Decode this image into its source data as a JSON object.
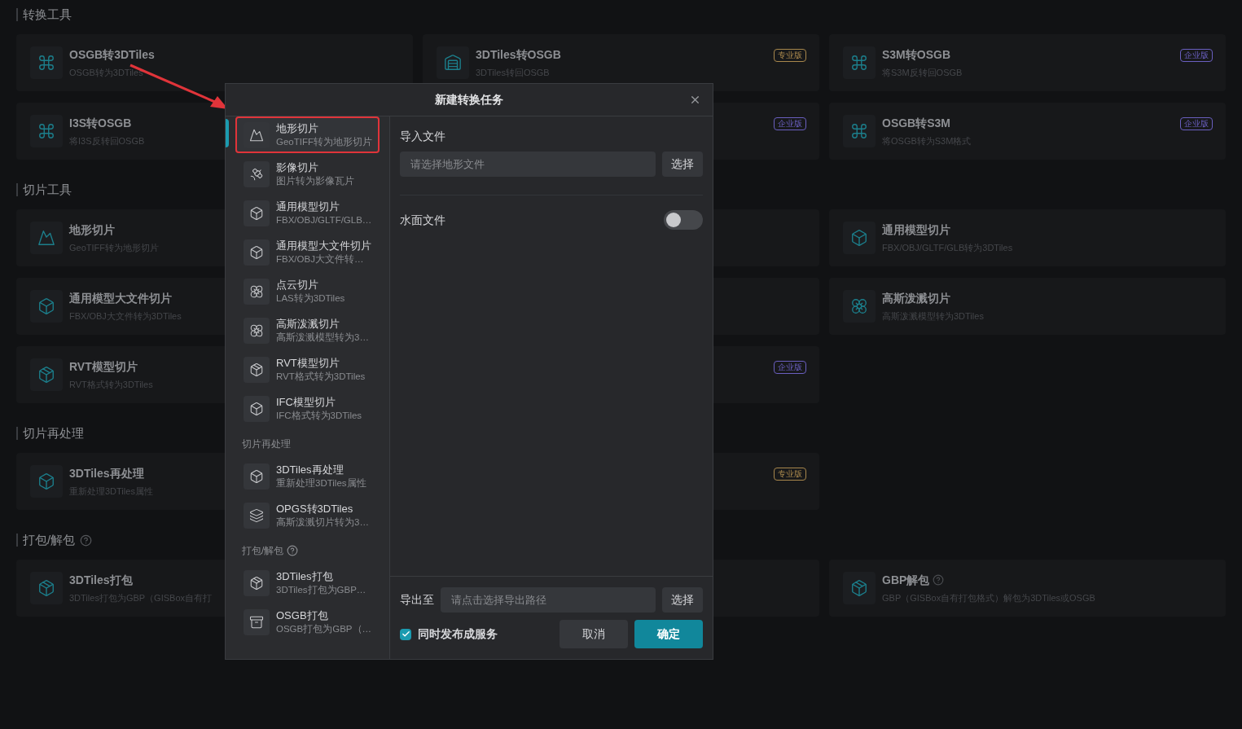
{
  "sections": [
    {
      "title": "转换工具",
      "help_icon": false,
      "cards": [
        {
          "kind": "tool",
          "title": "OSGB转3DTiles",
          "description": "OSGB转为3DTiles"
        },
        {
          "kind": "tool",
          "title": "3DTiles转OSGB",
          "description": "3DTiles转回OSGB",
          "badge": {
            "text": "专业版",
            "color": "#a8874c"
          }
        },
        {
          "kind": "tool",
          "title": "S3M转OSGB",
          "description": "将S3M反转回OSGB",
          "badge": {
            "text": "企业版",
            "color": "#6a5fc0"
          }
        },
        {
          "kind": "tool",
          "title": "I3S转OSGB",
          "description": "将I3S反转回OSGB"
        },
        {
          "kind": "covered",
          "badge": {
            "text": "企业版",
            "color": "#6a5fc0"
          }
        },
        {
          "kind": "tool",
          "title": "OSGB转S3M",
          "description": "将OSGB转为S3M格式",
          "badge": {
            "text": "企业版",
            "color": "#6a5fc0"
          }
        }
      ]
    },
    {
      "title": "切片工具",
      "help_icon": false,
      "cards": [
        {
          "kind": "tool",
          "title": "地形切片",
          "description": "GeoTIFF转为地形切片"
        },
        {
          "kind": "covered"
        },
        {
          "kind": "tool",
          "title": "通用模型切片",
          "description": "FBX/OBJ/GLTF/GLB转为3DTiles"
        },
        {
          "kind": "tool",
          "title": "通用模型大文件切片",
          "description": "FBX/OBJ大文件转为3DTiles"
        },
        {
          "kind": "covered"
        },
        {
          "kind": "tool",
          "title": "高斯泼溅切片",
          "description": "高斯泼溅模型转为3DTiles"
        },
        {
          "kind": "tool",
          "title": "RVT模型切片",
          "description": "RVT格式转为3DTiles"
        },
        {
          "kind": "covered",
          "badge": {
            "text": "企业版",
            "color": "#6a5fc0"
          }
        }
      ]
    },
    {
      "title": "切片再处理",
      "help_icon": false,
      "cards": [
        {
          "kind": "tool",
          "title": "3DTiles再处理",
          "description": "重新处理3DTiles属性"
        },
        {
          "kind": "covered",
          "badge": {
            "text": "专业版",
            "color": "#a8874c"
          }
        }
      ]
    },
    {
      "title": "打包/解包",
      "help_icon": true,
      "cards": [
        {
          "kind": "tool",
          "title": "3DTiles打包",
          "description": "3DTiles打包为GBP（GISBox自有打"
        },
        {
          "kind": "covered"
        },
        {
          "kind": "tool",
          "title": "GBP解包",
          "help_icon": true,
          "description": "GBP（GISBox自有打包格式）解包为3DTiles或OSGB"
        }
      ]
    }
  ],
  "dialog": {
    "title": "新建转换任务",
    "nav": [
      {
        "kind": "item",
        "title": "地形切片",
        "description": "GeoTIFF转为地形切片",
        "selected": true
      },
      {
        "kind": "item",
        "title": "影像切片",
        "description": "图片转为影像瓦片",
        "selected": false
      },
      {
        "kind": "item",
        "title": "通用模型切片",
        "description": "FBX/OBJ/GLTF/GLB…",
        "selected": false
      },
      {
        "kind": "item",
        "title": "通用模型大文件切片",
        "description": "FBX/OBJ大文件转…",
        "selected": false
      },
      {
        "kind": "item",
        "title": "点云切片",
        "description": "LAS转为3DTiles",
        "selected": false
      },
      {
        "kind": "item",
        "title": "高斯泼溅切片",
        "description": "高斯泼溅模型转为3…",
        "selected": false
      },
      {
        "kind": "item",
        "title": "RVT模型切片",
        "description": "RVT格式转为3DTiles",
        "selected": false
      },
      {
        "kind": "item",
        "title": "IFC模型切片",
        "description": "IFC格式转为3DTiles",
        "selected": false
      },
      {
        "kind": "group",
        "label": "切片再处理",
        "help_icon": false
      },
      {
        "kind": "item",
        "title": "3DTiles再处理",
        "description": "重新处理3DTiles属性",
        "selected": false
      },
      {
        "kind": "item",
        "title": "OPGS转3DTiles",
        "description": "高斯泼溅切片转为3…",
        "selected": false
      },
      {
        "kind": "group",
        "label": "打包/解包",
        "help_icon": true
      },
      {
        "kind": "item",
        "title": "3DTiles打包",
        "description": "3DTiles打包为GBP…",
        "selected": false
      },
      {
        "kind": "item",
        "title": "OSGB打包",
        "description": "OSGB打包为GBP（…",
        "selected": false
      }
    ],
    "import": {
      "label": "导入文件",
      "placeholder": "请选择地形文件",
      "button": "选择"
    },
    "water": {
      "label": "水面文件",
      "on": false
    },
    "export": {
      "label": "导出至",
      "placeholder": "请点击选择导出路径",
      "button": "选择"
    },
    "publish": {
      "label": "同时发布成服务",
      "checked": true
    },
    "cancel": "取消",
    "confirm": "确定"
  }
}
